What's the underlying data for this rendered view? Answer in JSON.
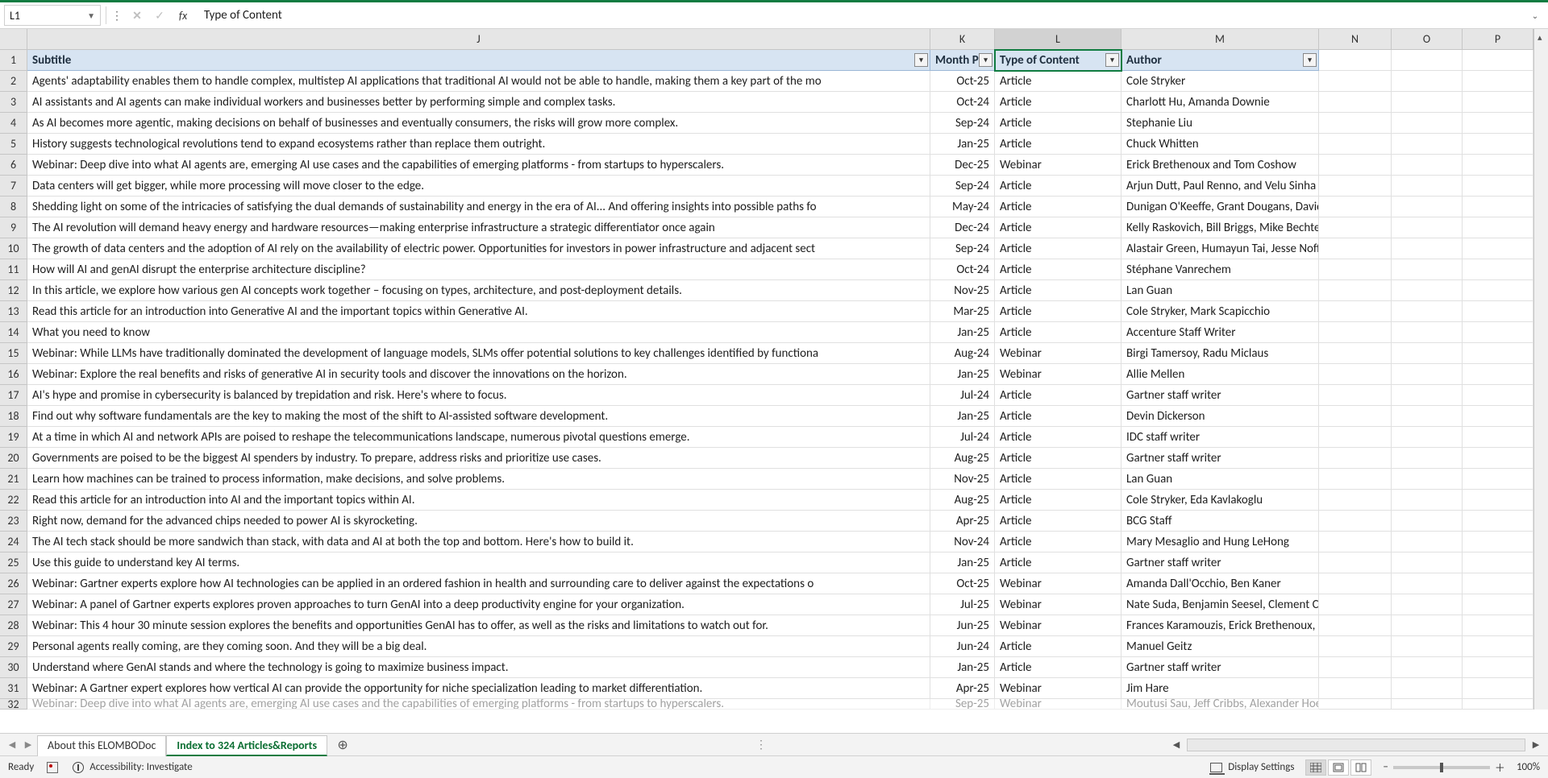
{
  "name_box": "L1",
  "formula_text": "Type of Content",
  "columns": [
    "J",
    "K",
    "L",
    "M",
    "N",
    "O",
    "P"
  ],
  "selected_column_index": 2,
  "header_row": {
    "J": "Subtitle",
    "K": "Month P",
    "L": "Type of Content",
    "M": "Author"
  },
  "rows": [
    {
      "n": 2,
      "subtitle": "Agents' adaptability enables them to handle complex, multistep AI applications that traditional AI would not be able to handle, making them a key part of the mo",
      "month": "Oct-25",
      "type": "Article",
      "author": "Cole Stryker"
    },
    {
      "n": 3,
      "subtitle": "AI assistants and AI agents can make individual workers and businesses better by performing simple and complex tasks.",
      "month": "Oct-24",
      "type": "Article",
      "author": "Charlott Hu, Amanda Downie"
    },
    {
      "n": 4,
      "subtitle": "As AI becomes more agentic, making decisions on behalf of businesses and eventually consumers, the risks will grow more complex.",
      "month": "Sep-24",
      "type": "Article",
      "author": "Stephanie Liu"
    },
    {
      "n": 5,
      "subtitle": "History suggests technological revolutions tend to expand ecosystems rather than replace them outright.",
      "month": "Jan-25",
      "type": "Article",
      "author": "Chuck Whitten"
    },
    {
      "n": 6,
      "subtitle": "Webinar: Deep dive into what AI agents are, emerging AI use cases and the capabilities of emerging platforms - from startups to hyperscalers.",
      "month": "Dec-25",
      "type": "Webinar",
      "author": "Erick Brethenoux and Tom Coshow"
    },
    {
      "n": 7,
      "subtitle": "Data centers will get bigger, while more processing will move closer to the edge.",
      "month": "Sep-24",
      "type": "Article",
      "author": "Arjun Dutt, Paul Renno, and Velu Sinha"
    },
    {
      "n": 8,
      "subtitle": "Shedding light on some of the intricacies of satisfying the dual demands of sustainability and energy in the era of AI... And offering insights into possible paths fo",
      "month": "May-24",
      "type": "Article",
      "author": "Dunigan O'Keeffe, Grant Dougans, David Crawford, Aaron Denman, Ani"
    },
    {
      "n": 9,
      "subtitle": "The AI revolution will demand heavy energy and hardware resources—making enterprise infrastructure a strategic differentiator once again",
      "month": "Dec-24",
      "type": "Article",
      "author": "Kelly Raskovich, Bill Briggs, Mike Bechtel, Abhijith Ravinutala"
    },
    {
      "n": 10,
      "subtitle": "The growth of data centers and the adoption of AI rely on the availability of electric power. Opportunities for investors in power infrastructure and adjacent sect",
      "month": "Sep-24",
      "type": "Article",
      "author": "Alastair Green, Humayun Tai, Jesse Noffsinger, Pankaj Sachdeva, Arjita"
    },
    {
      "n": 11,
      "subtitle": "How will AI and genAI disrupt the enterprise architecture discipline?",
      "month": "Oct-24",
      "type": "Article",
      "author": "Stéphane Vanrechem"
    },
    {
      "n": 12,
      "subtitle": "In this article, we explore how various gen AI concepts work together – focusing on types, architecture, and post-deployment details.",
      "month": "Nov-25",
      "type": "Article",
      "author": "Lan Guan"
    },
    {
      "n": 13,
      "subtitle": "Read this article for an introduction into Generative AI and the important topics within Generative AI.",
      "month": "Mar-25",
      "type": "Article",
      "author": "Cole Stryker, Mark Scapicchio"
    },
    {
      "n": 14,
      "subtitle": "What you need to know",
      "month": "Jan-25",
      "type": "Article",
      "author": "Accenture Staff Writer"
    },
    {
      "n": 15,
      "subtitle": "Webinar: While LLMs have traditionally dominated the development of language models, SLMs offer potential solutions to key challenges identified by functiona",
      "month": "Aug-24",
      "type": "Webinar",
      "author": "Birgi Tamersoy, Radu Miclaus"
    },
    {
      "n": 16,
      "subtitle": "Webinar: Explore the real benefits and risks of generative AI in security tools and discover the innovations on the horizon.",
      "month": "Jan-25",
      "type": "Webinar",
      "author": "Allie Mellen"
    },
    {
      "n": 17,
      "subtitle": "AI's hype and promise in cybersecurity is balanced by trepidation and risk. Here's where to focus.",
      "month": "Jul-24",
      "type": "Article",
      "author": "Gartner staff writer"
    },
    {
      "n": 18,
      "subtitle": "Find out why software fundamentals are the key to making the most of the shift to AI-assisted software development.",
      "month": "Jan-25",
      "type": "Article",
      "author": "Devin Dickerson"
    },
    {
      "n": 19,
      "subtitle": "At a time in which AI and network APIs are poised to reshape the telecommunications landscape, numerous pivotal questions emerge.",
      "month": "Jul-24",
      "type": "Article",
      "author": "IDC staff writer"
    },
    {
      "n": 20,
      "subtitle": "Governments are poised to be the biggest AI spenders by industry. To prepare, address risks and prioritize use cases.",
      "month": "Aug-25",
      "type": "Article",
      "author": "Gartner staff writer"
    },
    {
      "n": 21,
      "subtitle": "Learn how machines can be trained to process information, make decisions, and solve problems.",
      "month": "Nov-25",
      "type": "Article",
      "author": "Lan Guan"
    },
    {
      "n": 22,
      "subtitle": "Read this article for an introduction into AI and the important topics within AI.",
      "month": "Aug-25",
      "type": "Article",
      "author": "Cole Stryker, Eda Kavlakoglu"
    },
    {
      "n": 23,
      "subtitle": "Right now, demand for the advanced chips needed to power AI is skyrocketing.",
      "month": "Apr-25",
      "type": "Article",
      "author": "BCG Staff"
    },
    {
      "n": 24,
      "subtitle": "The AI tech stack should be more sandwich than stack, with data and AI at both the top and bottom. Here's how to build it.",
      "month": "Nov-24",
      "type": "Article",
      "author": "Mary Mesaglio and Hung LeHong"
    },
    {
      "n": 25,
      "subtitle": "Use this guide to understand key AI terms.",
      "month": "Jan-25",
      "type": "Article",
      "author": "Gartner staff writer"
    },
    {
      "n": 26,
      "subtitle": "Webinar: Gartner experts explore how AI technologies can be applied in an ordered fashion in health and surrounding care to deliver against the expectations o",
      "month": "Oct-25",
      "type": "Webinar",
      "author": "Amanda Dall'Occhio, Ben Kaner"
    },
    {
      "n": 27,
      "subtitle": "Webinar: A panel of Gartner experts explores proven approaches to turn GenAI into a deep productivity engine for your organization.",
      "month": "Jul-25",
      "type": "Webinar",
      "author": "Nate Suda, Benjamin Seesel, Clement Christensen"
    },
    {
      "n": 28,
      "subtitle": "Webinar: This 4 hour 30 minute session explores the benefits and opportunities GenAI has to offer, as well as the risks and limitations to watch out for.",
      "month": "Jun-25",
      "type": "Webinar",
      "author": "Frances Karamouzis, Erick Brethenoux, Helen Poitevin, Uma Challa, Ar"
    },
    {
      "n": 29,
      "subtitle": "Personal agents really coming, are they coming soon. And they will be a big deal.",
      "month": "Jun-24",
      "type": "Article",
      "author": "Manuel Geitz"
    },
    {
      "n": 30,
      "subtitle": "Understand where GenAI stands and where the technology is going to maximize business impact.",
      "month": "Jan-25",
      "type": "Article",
      "author": "Gartner staff writer"
    },
    {
      "n": 31,
      "subtitle": "Webinar: A Gartner expert explores how vertical AI can provide the opportunity for niche specialization leading to market differentiation.",
      "month": "Apr-25",
      "type": "Webinar",
      "author": "Jim Hare"
    }
  ],
  "partial_row": {
    "n": 32,
    "subtitle": "Webinar: Deep dive into what AI agents are, emerging AI use cases and the capabilities of emerging platforms - from startups to hyperscalers.",
    "month": "Sep-25",
    "type": "Webinar",
    "author": "Moutusi Sau, Jeff Cribbs, Alexander Hoeppe"
  },
  "tabs": [
    {
      "label": "About this ELOMBODoc",
      "active": false
    },
    {
      "label": "Index to 324 Articles&Reports",
      "active": true
    }
  ],
  "status": {
    "ready": "Ready",
    "accessibility": "Accessibility: Investigate",
    "display_settings": "Display Settings",
    "zoom": "100%"
  }
}
